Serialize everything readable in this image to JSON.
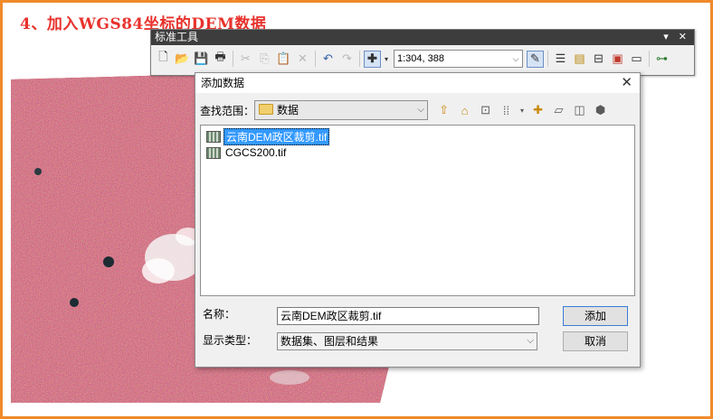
{
  "heading": "4、加入WGS84坐标的DEM数据",
  "toolbar": {
    "title": "标准工具",
    "controls": "▾ ✕",
    "scale_value": "1:304, 388"
  },
  "dialog": {
    "title": "添加数据",
    "look_in_label": "查找范围：",
    "look_in_value": "数据",
    "files": [
      {
        "name": "云南DEM政区裁剪.tif",
        "selected": true
      },
      {
        "name": "CGCS200.tif",
        "selected": false
      }
    ],
    "name_label": "名称：",
    "name_value": "云南DEM政区裁剪.tif",
    "type_label": "显示类型：",
    "type_value": "数据集、图层和结果",
    "add_button": "添加",
    "cancel_button": "取消"
  },
  "colors": {
    "heading": "#e8322d",
    "frame": "#f08a2a",
    "selection": "#3399ff"
  }
}
